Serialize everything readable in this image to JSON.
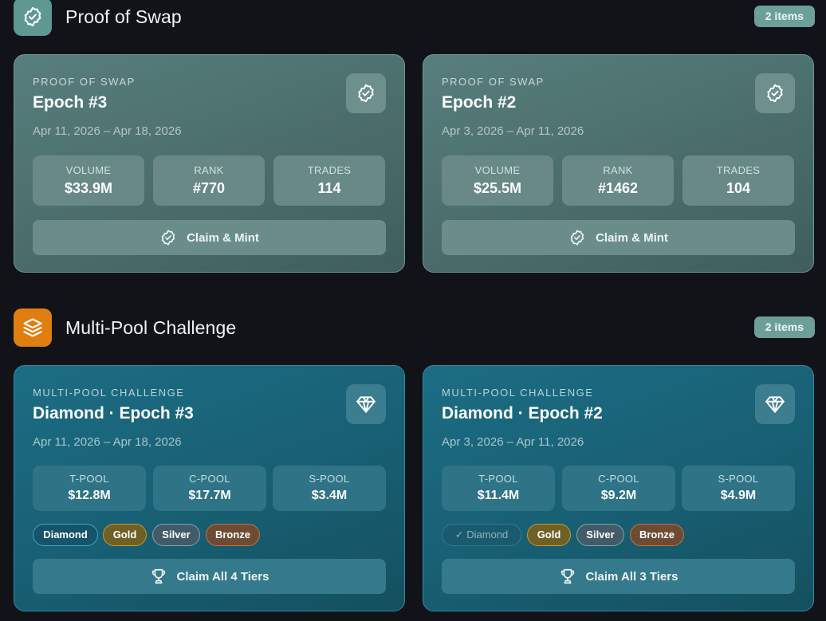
{
  "sections": [
    {
      "title": "Proof of Swap",
      "icon": "verified-badge-icon",
      "count": "2 items",
      "cards": [
        {
          "eyebrow": "PROOF OF SWAP",
          "title": "Epoch #3",
          "dates": "Apr 11, 2026 – Apr 18, 2026",
          "icon": "verified-badge-icon",
          "stats": [
            {
              "label": "VOLUME",
              "value": "$33.9M"
            },
            {
              "label": "RANK",
              "value": "#770"
            },
            {
              "label": "TRADES",
              "value": "114"
            }
          ],
          "action": "Claim & Mint"
        },
        {
          "eyebrow": "PROOF OF SWAP",
          "title": "Epoch #2",
          "dates": "Apr 3, 2026 – Apr 11, 2026",
          "icon": "verified-badge-icon",
          "stats": [
            {
              "label": "VOLUME",
              "value": "$25.5M"
            },
            {
              "label": "RANK",
              "value": "#1462"
            },
            {
              "label": "TRADES",
              "value": "104"
            }
          ],
          "action": "Claim & Mint"
        }
      ]
    },
    {
      "title": "Multi-Pool Challenge",
      "icon": "layers-icon",
      "count": "2 items",
      "cards": [
        {
          "eyebrow": "MULTI-POOL CHALLENGE",
          "title": "Diamond · Epoch #3",
          "dates": "Apr 11, 2026 – Apr 18, 2026",
          "icon": "diamond-icon",
          "stats": [
            {
              "label": "T-POOL",
              "value": "$12.8M"
            },
            {
              "label": "C-POOL",
              "value": "$17.7M"
            },
            {
              "label": "S-POOL",
              "value": "$3.4M"
            }
          ],
          "tiers": [
            {
              "label": "Diamond",
              "claimed": false
            },
            {
              "label": "Gold",
              "claimed": false
            },
            {
              "label": "Silver",
              "claimed": false
            },
            {
              "label": "Bronze",
              "claimed": false
            }
          ],
          "action": "Claim All 4 Tiers"
        },
        {
          "eyebrow": "MULTI-POOL CHALLENGE",
          "title": "Diamond · Epoch #2",
          "dates": "Apr 3, 2026 – Apr 11, 2026",
          "icon": "diamond-icon",
          "stats": [
            {
              "label": "T-POOL",
              "value": "$11.4M"
            },
            {
              "label": "C-POOL",
              "value": "$9.2M"
            },
            {
              "label": "S-POOL",
              "value": "$4.9M"
            }
          ],
          "tiers": [
            {
              "label": "Diamond",
              "claimed": true,
              "check": "✓"
            },
            {
              "label": "Gold",
              "claimed": false
            },
            {
              "label": "Silver",
              "claimed": false
            },
            {
              "label": "Bronze",
              "claimed": false
            }
          ],
          "action": "Claim All 3 Tiers"
        }
      ]
    }
  ],
  "colors": {
    "background": "#111318",
    "pos_accent": "#5f9792",
    "mpc_accent": "#e07f10",
    "diamond": "#3aa7c7",
    "gold": "#c29b32",
    "silver": "#8aa0aa",
    "bronze": "#b9744b"
  }
}
